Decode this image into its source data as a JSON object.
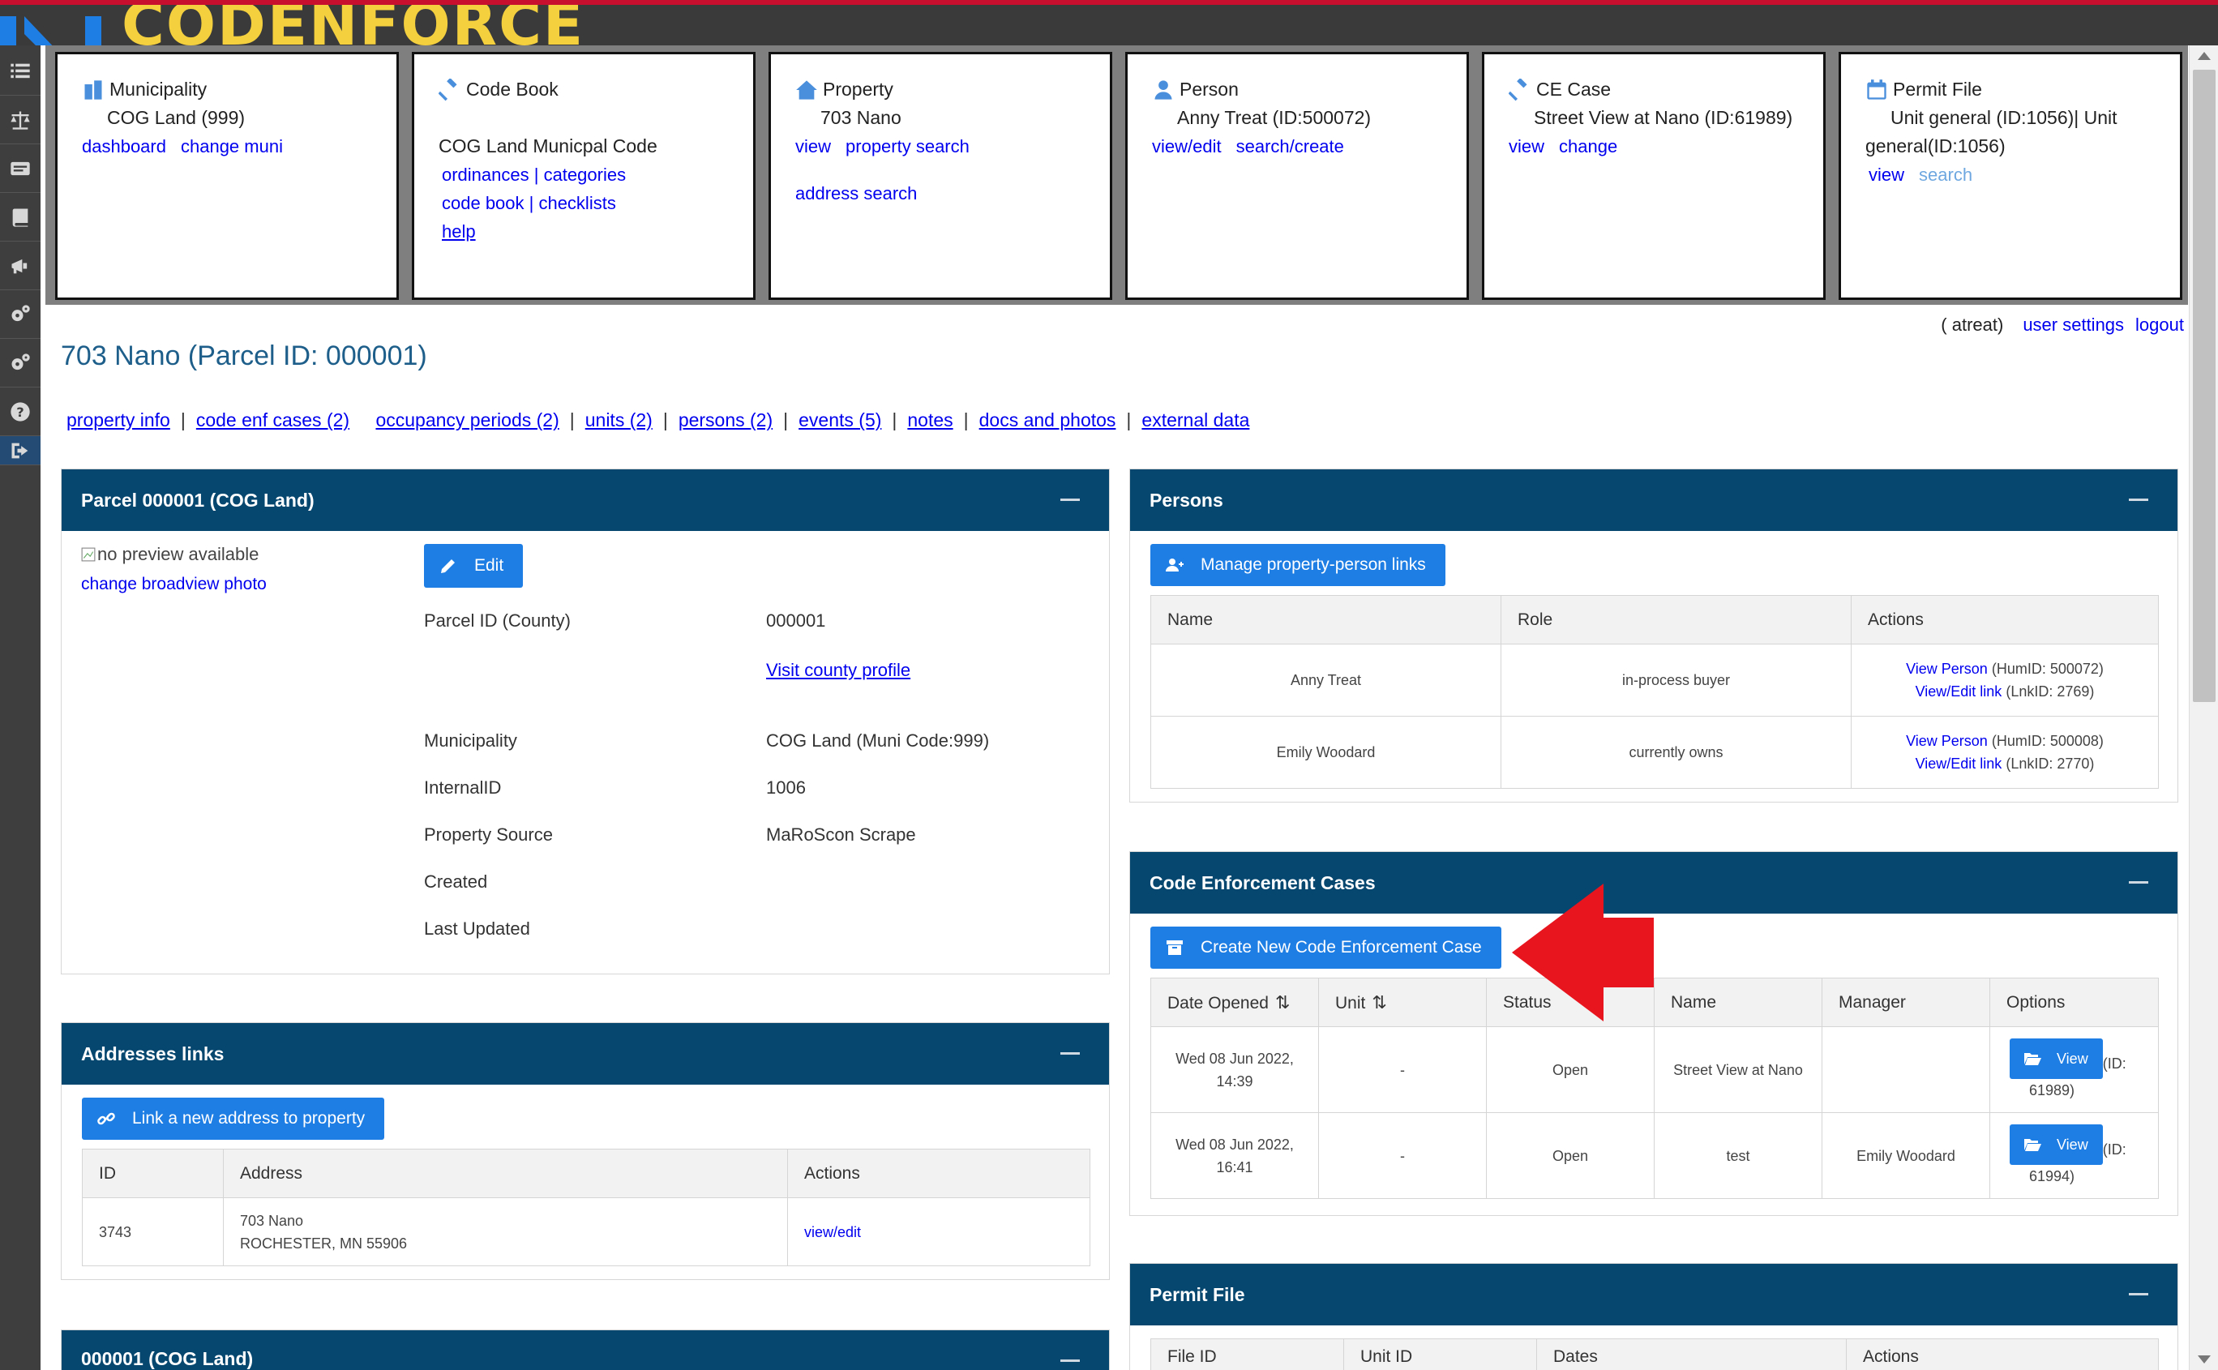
{
  "app": {
    "logo_text": "CODENFORCE",
    "brand_color": "#f4d03f",
    "header_color": "#064770",
    "accent": "#1f7ee3"
  },
  "sidebar": {
    "items": [
      {
        "icon": "list-icon"
      },
      {
        "icon": "scale-icon"
      },
      {
        "icon": "id-card-icon"
      },
      {
        "icon": "book-icon"
      },
      {
        "icon": "megaphone-icon"
      },
      {
        "icon": "gears-icon"
      },
      {
        "icon": "gears-icon"
      },
      {
        "icon": "help-icon"
      },
      {
        "icon": "logout-icon"
      }
    ]
  },
  "cards": {
    "municipality": {
      "title": "Municipality",
      "value": "COG Land (999)",
      "links": [
        "dashboard",
        "change muni"
      ]
    },
    "codebook": {
      "title": "Code Book",
      "value": "COG Land Municpal Code",
      "links": [
        "ordinances | categories",
        "code book | checklists",
        "help"
      ]
    },
    "property": {
      "title": "Property",
      "value": "703 Nano",
      "links": [
        "view",
        "property search",
        "address search"
      ]
    },
    "person": {
      "title": "Person",
      "value": "Anny Treat (ID:500072)",
      "links": [
        "view/edit",
        "search/create"
      ]
    },
    "cecase": {
      "title": "CE Case",
      "value": "Street View at Nano (ID:61989)",
      "links": [
        "view",
        "change"
      ]
    },
    "permit": {
      "title": "Permit File",
      "value_line1": "Unit general (ID:1056)| Unit",
      "value_line2": "general(ID:1056)",
      "links": [
        "view",
        "search"
      ]
    }
  },
  "user": {
    "name": "( atreat)",
    "settings": "user settings",
    "logout": "logout"
  },
  "page": {
    "title": "703 Nano (Parcel ID: 000001)"
  },
  "tabs": [
    "property info",
    "code enf cases (2)",
    "occupancy periods (2)",
    "units (2)",
    "persons (2)",
    "events (5)",
    "notes",
    "docs and photos",
    "external data"
  ],
  "parcel_panel": {
    "title": "Parcel 000001 (COG Land)",
    "image_alt": "no preview available",
    "photo_link": "change broadview photo",
    "edit_label": "Edit",
    "fields": [
      {
        "label": "Parcel ID (County)",
        "value": "000001"
      },
      {
        "label": "",
        "value": "Visit county profile"
      },
      {
        "label": "Municipality",
        "value": "COG Land (Muni Code:999)"
      },
      {
        "label": "InternalID",
        "value": "1006"
      },
      {
        "label": "Property Source",
        "value": "MaRoScon Scrape"
      },
      {
        "label": "Created",
        "value": ""
      },
      {
        "label": "Last Updated",
        "value": ""
      }
    ]
  },
  "addresses_panel": {
    "title": "Addresses links",
    "button": "Link a new address to property",
    "columns": [
      "ID",
      "Address",
      "Actions"
    ],
    "rows": [
      {
        "id": "3743",
        "line1": "703 Nano",
        "line2": "ROCHESTER, MN 55906",
        "action": "view/edit"
      }
    ]
  },
  "bottom_panel": {
    "title": "000001 (COG Land)"
  },
  "persons_panel": {
    "title": "Persons",
    "button": "Manage property-person links",
    "columns": [
      "Name",
      "Role",
      "Actions"
    ],
    "rows": [
      {
        "name": "Anny Treat",
        "role": "in-process buyer",
        "view": "View Person",
        "hum": "(HumID: 500072)",
        "link": "View/Edit link",
        "lnk": "(LnkID: 2769)"
      },
      {
        "name": "Emily Woodard",
        "role": "currently owns",
        "view": "View Person",
        "hum": "(HumID: 500008)",
        "link": "View/Edit link",
        "lnk": "(LnkID: 2770)"
      }
    ]
  },
  "cases_panel": {
    "title": "Code Enforcement Cases",
    "button": "Create New Code Enforcement Case",
    "columns": [
      "Date Opened",
      "Unit",
      "Status",
      "Name",
      "Manager",
      "Options"
    ],
    "rows": [
      {
        "date": "Wed 08 Jun 2022, 14:39",
        "unit": "-",
        "status": "Open",
        "name": "Street View at Nano",
        "manager": "",
        "view": "View",
        "id_a": "(ID:",
        "id_b": "61989)"
      },
      {
        "date": "Wed 08 Jun 2022, 16:41",
        "unit": "-",
        "status": "Open",
        "name": "test",
        "manager": "Emily Woodard",
        "view": "View",
        "id_a": "(ID:",
        "id_b": "61994)"
      }
    ]
  },
  "permit_panel": {
    "title": "Permit File",
    "columns": [
      "File ID",
      "Unit ID",
      "Dates",
      "Actions"
    ]
  },
  "annotation": {
    "arrow_color": "#e8141e"
  }
}
